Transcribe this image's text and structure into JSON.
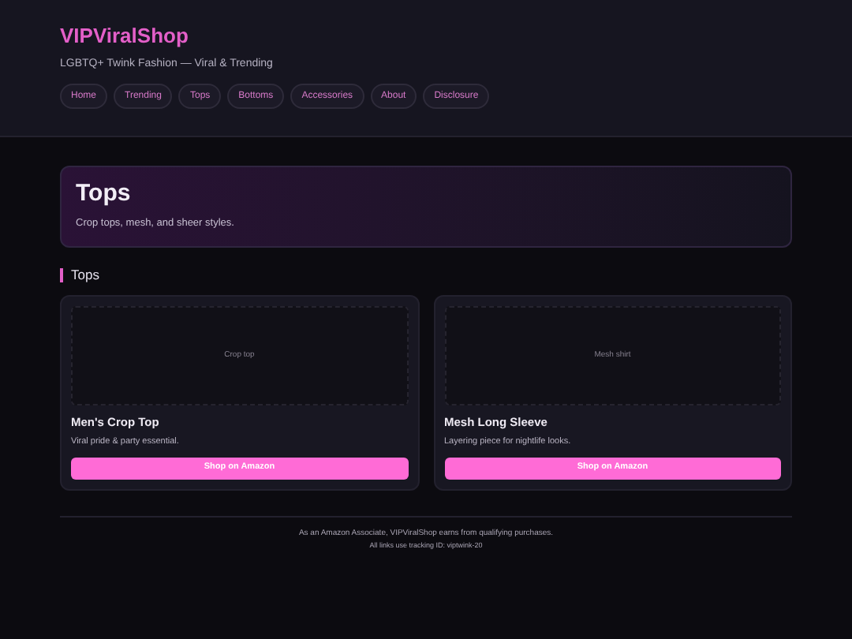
{
  "header": {
    "title": "VIPViralShop",
    "tagline": "LGBTQ+ Twink Fashion — Viral & Trending",
    "nav": [
      "Home",
      "Trending",
      "Tops",
      "Bottoms",
      "Accessories",
      "About",
      "Disclosure"
    ]
  },
  "hero": {
    "title": "Tops",
    "subtitle": "Crop tops, mesh, and sheer styles."
  },
  "section": {
    "heading": "Tops"
  },
  "products": [
    {
      "image_label": "Crop top",
      "name": "Men's Crop Top",
      "description": "Viral pride & party essential.",
      "button": "Shop on Amazon"
    },
    {
      "image_label": "Mesh shirt",
      "name": "Mesh Long Sleeve",
      "description": "Layering piece for nightlife looks.",
      "button": "Shop on Amazon"
    }
  ],
  "footer": {
    "disclosure": "As an Amazon Associate, VIPViralShop earns from qualifying purchases.",
    "tracking": "All links use tracking ID: viptwink-20"
  }
}
